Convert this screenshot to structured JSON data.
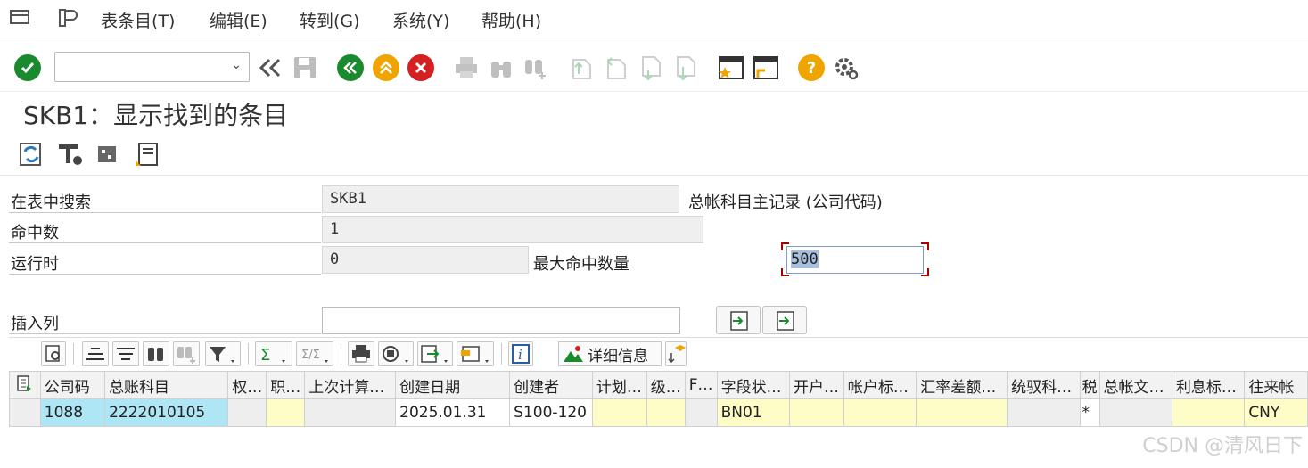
{
  "menubar": {
    "items": [
      "表条目(T)",
      "编辑(E)",
      "转到(G)",
      "系统(Y)",
      "帮助(H)"
    ]
  },
  "toolbar": {
    "command_value": "",
    "icons": [
      "enter-icon",
      "back-arrows-icon",
      "save-icon",
      "back-icon",
      "exit-icon",
      "cancel-icon",
      "print-icon",
      "find-icon",
      "find-next-icon",
      "first-page-icon",
      "prev-page-icon",
      "next-page-icon",
      "last-page-icon",
      "create-session-icon",
      "shortcut-icon",
      "help-icon",
      "settings-icon"
    ],
    "colors": {
      "enter": "#1a8a2e",
      "back": "#1a8a2e",
      "exit": "#f0a400",
      "cancel": "#d42020",
      "help": "#f0a400"
    }
  },
  "page": {
    "title": "SKB1：显示找到的条目"
  },
  "form": {
    "search_table_label": "在表中搜索",
    "search_table_value": "SKB1",
    "search_table_desc": "总帐科目主记录 (公司代码)",
    "hits_label": "命中数",
    "hits_value": "1",
    "runtime_label": "运行时",
    "runtime_value": "0",
    "max_hits_label": "最大命中数量",
    "max_hits_value": "500",
    "insert_col_label": "插入列",
    "insert_col_value": ""
  },
  "grid_toolbar": {
    "detail_label": "详细信息"
  },
  "grid": {
    "headers": [
      "公司码",
      "总账科目",
      "权…",
      "职…",
      "上次计算…",
      "创建日期",
      "创建者",
      "计划…",
      "级…",
      "F…",
      "字段状…",
      "开户…",
      "帐户标…",
      "汇率差额…",
      "统驭科…",
      "税",
      "总帐文…",
      "利息标…",
      "往来帐"
    ],
    "rows": [
      [
        "1088",
        "2222010105",
        "",
        "",
        "",
        "2025.01.31",
        "S100-120",
        "",
        "",
        "",
        "BN01",
        "",
        "",
        "",
        "",
        "*",
        "",
        "",
        "CNY"
      ]
    ]
  },
  "watermark": "CSDN @清风日下"
}
